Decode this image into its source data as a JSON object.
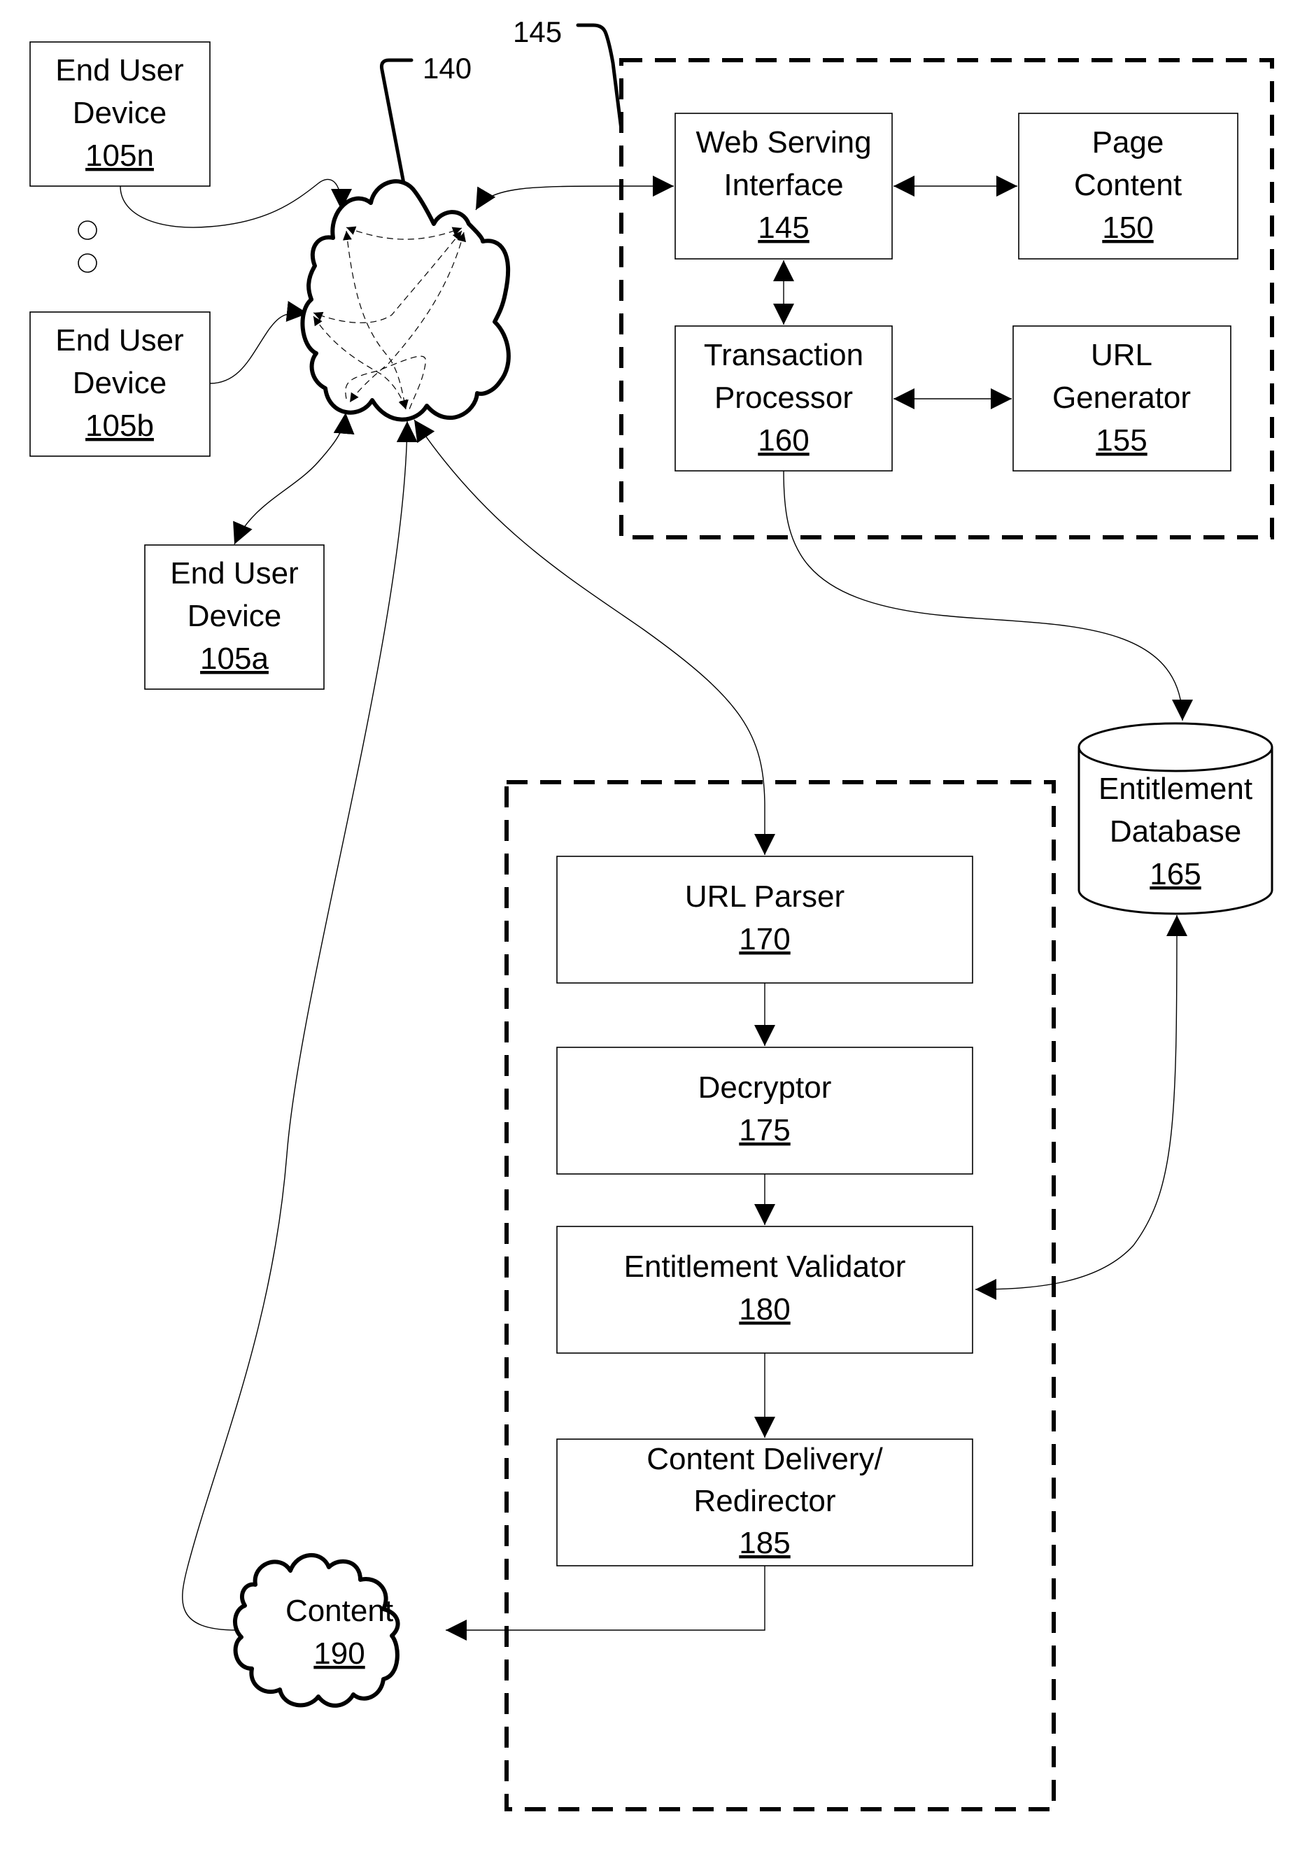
{
  "figure": {
    "reference_labels": {
      "network": "140",
      "server_group": "145"
    },
    "end_user_devices": [
      {
        "line1": "End User",
        "line2": "Device",
        "number": "105n"
      },
      {
        "line1": "End User",
        "line2": "Device",
        "number": "105b"
      },
      {
        "line1": "End User",
        "line2": "Device",
        "number": "105a"
      }
    ],
    "server_components": {
      "web_serving_interface": {
        "line1": "Web Serving",
        "line2": "Interface",
        "number": "145"
      },
      "page_content": {
        "line1": "Page",
        "line2": "Content",
        "number": "150"
      },
      "transaction_processor": {
        "line1": "Transaction",
        "line2": "Processor",
        "number": "160"
      },
      "url_generator": {
        "line1": "URL",
        "line2": "Generator",
        "number": "155"
      }
    },
    "entitlement_database": {
      "line1": "Entitlement",
      "line2": "Database",
      "number": "165"
    },
    "delivery_components": {
      "url_parser": {
        "line1": "URL Parser",
        "number": "170"
      },
      "decryptor": {
        "line1": "Decryptor",
        "number": "175"
      },
      "entitlement_validator": {
        "line1": "Entitlement Validator",
        "number": "180"
      },
      "content_delivery": {
        "line1": "Content Delivery/",
        "line2": "Redirector",
        "number": "185"
      }
    },
    "content_cloud": {
      "line1": "Content",
      "number": "190"
    }
  }
}
